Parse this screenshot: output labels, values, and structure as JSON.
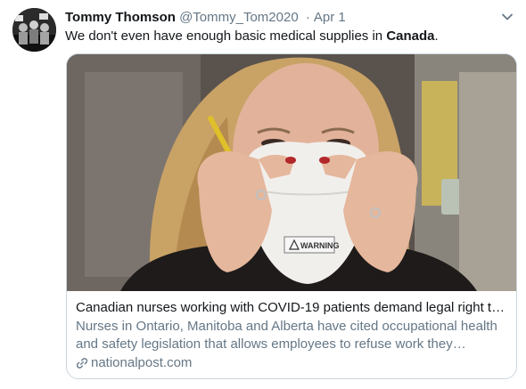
{
  "tweet": {
    "author_name": "Tommy Thomson",
    "author_handle": "@Tommy_Tom2020",
    "separator": "·",
    "date": "Apr 1",
    "text_prefix": "We don't even have enough basic medical supplies in ",
    "text_bold": "Canada",
    "text_suffix": "."
  },
  "card": {
    "title": "Canadian nurses working with COVID-19 patients demand legal right to...",
    "description": "Nurses in Ontario, Manitoba and Alberta have cited occupational health and safety legislation that allows employees to refuse work they believe...",
    "domain": "nationalpost.com",
    "mask_text": "WARNING"
  },
  "icons": {
    "caret": "chevron-down-icon",
    "link": "link-icon"
  },
  "colors": {
    "text": "#14171a",
    "secondary": "#657786",
    "border": "#ccd6dd"
  }
}
